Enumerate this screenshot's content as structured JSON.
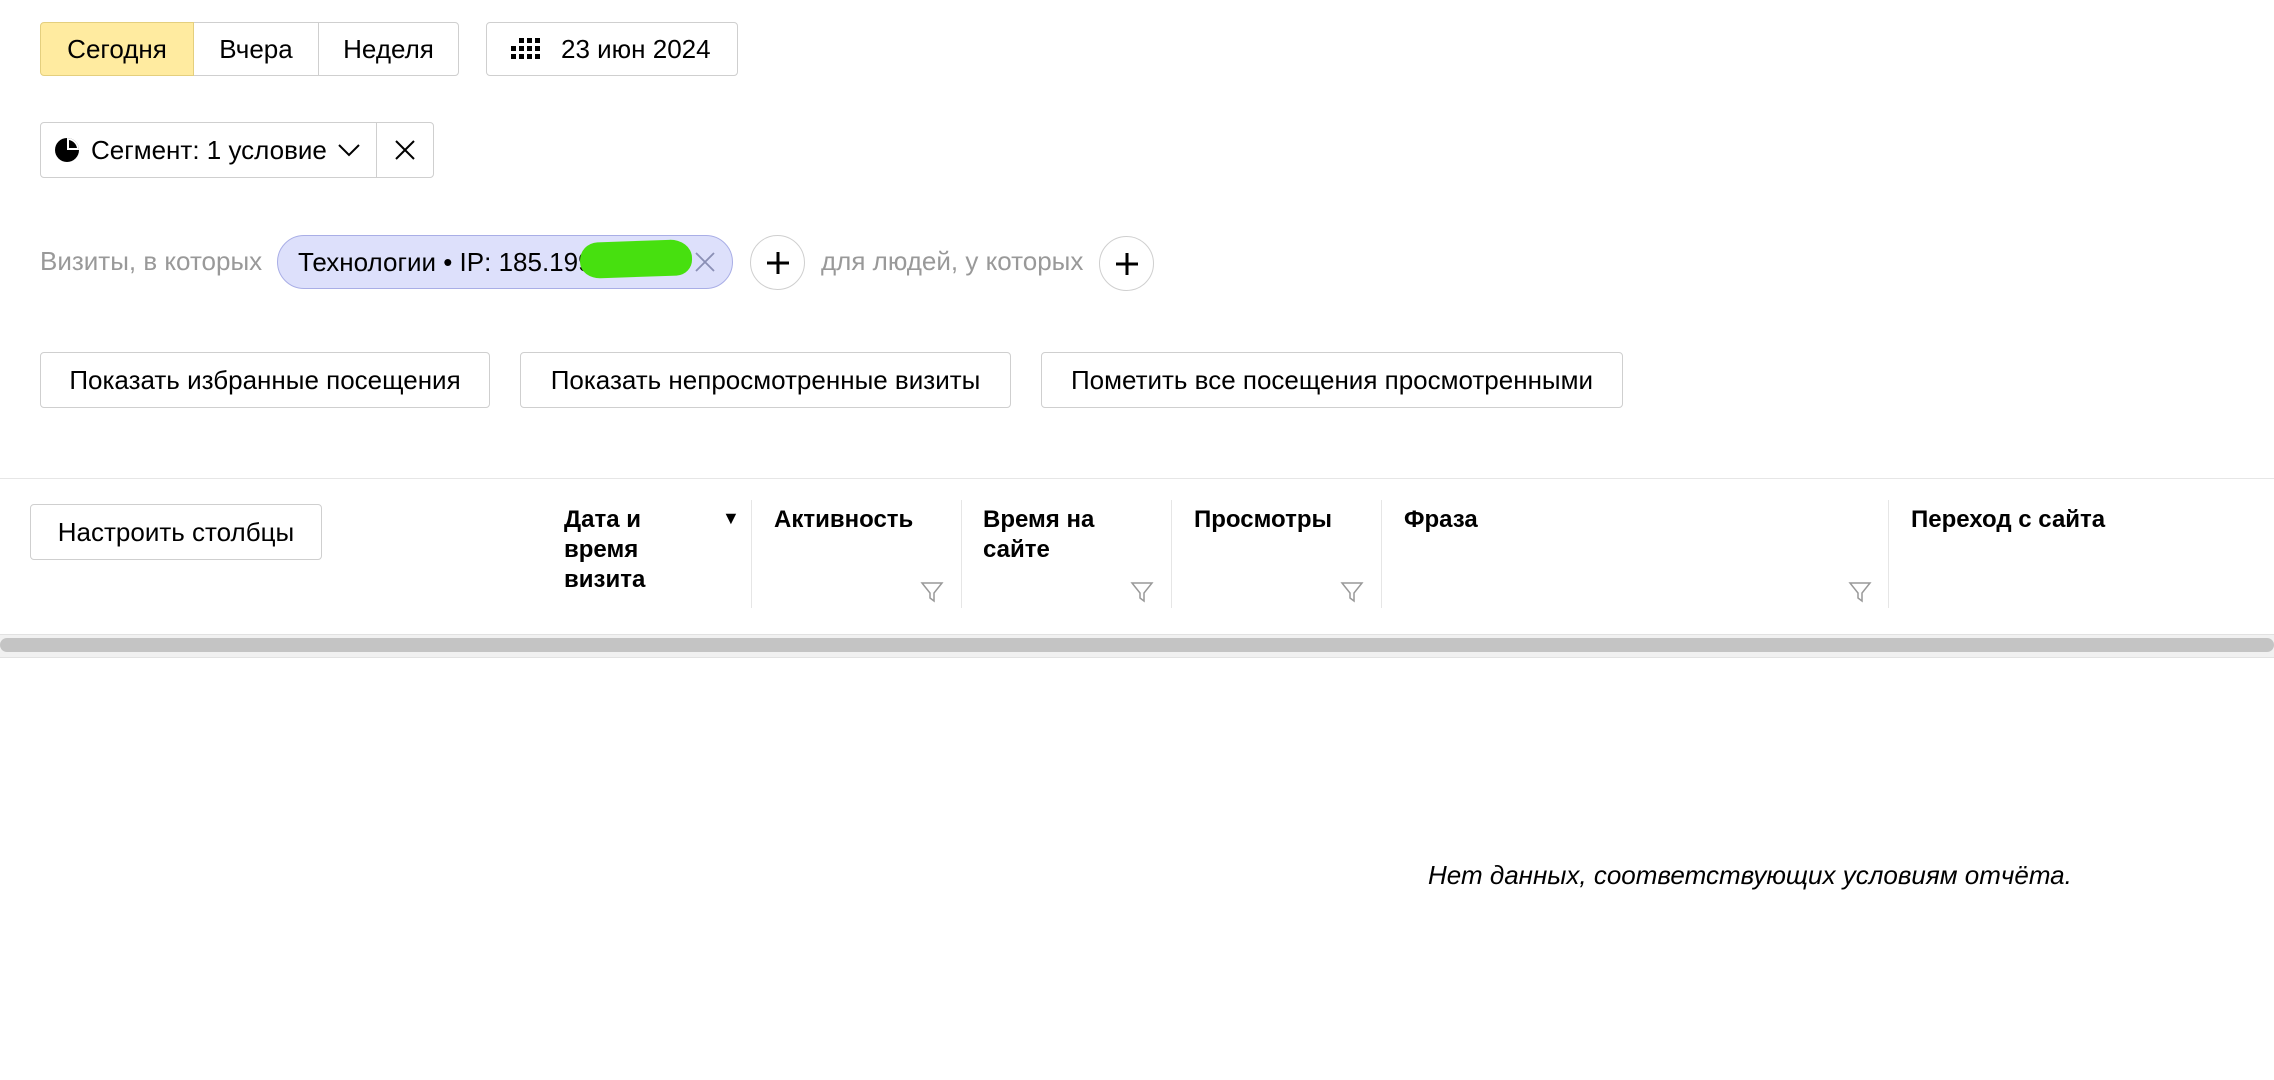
{
  "period": {
    "tabs": [
      {
        "label": "Сегодня",
        "active": true
      },
      {
        "label": "Вчера",
        "active": false
      },
      {
        "label": "Неделя",
        "active": false
      }
    ],
    "date_label": "23 июн 2024"
  },
  "segment": {
    "label": "Сегмент: 1 условие",
    "icons": {
      "pie": "pie-chart-icon",
      "dropdown": "chevron-down-icon",
      "clear": "close-icon"
    }
  },
  "conditions": {
    "visits_label": "Визиты, в которых",
    "chip_text": "Технологии • IP: 185.199.",
    "people_label": "для людей, у которых"
  },
  "actions": {
    "show_favorites": "Показать избранные посещения",
    "show_unviewed": "Показать непросмотренные визиты",
    "mark_all_viewed": "Пометить все посещения просмотренными"
  },
  "table": {
    "configure_columns": "Настроить столбцы",
    "columns": [
      {
        "label": "Дата и время визита",
        "sort": "desc"
      },
      {
        "label": "Активность"
      },
      {
        "label": "Время на сайте"
      },
      {
        "label": "Просмотры"
      },
      {
        "label": "Фраза"
      },
      {
        "label": "Переход с сайта"
      }
    ],
    "empty_message": "Нет данных, соответствующих условиям отчёта."
  },
  "colors": {
    "active_tab_bg": "#ffeba0",
    "chip_bg": "#dde0fb",
    "chip_border": "#a9aee6",
    "muted_text": "#999999",
    "border": "#cfcfcf"
  }
}
